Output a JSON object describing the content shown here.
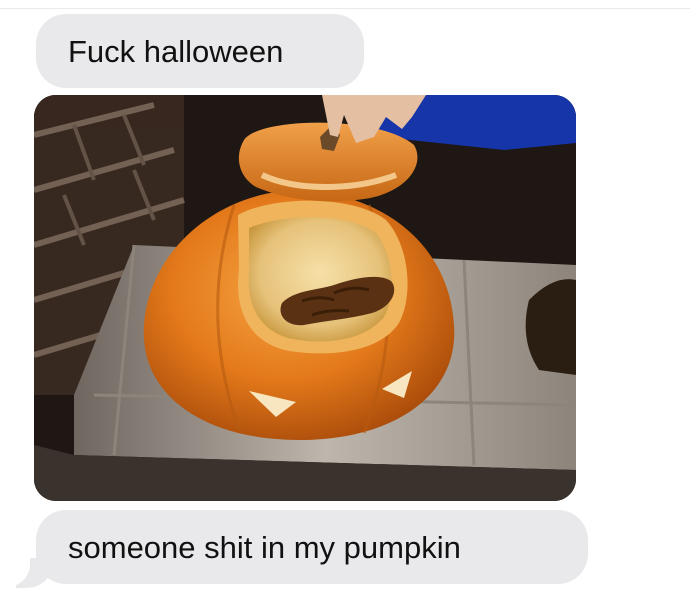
{
  "conversation": {
    "messages": [
      {
        "type": "text",
        "text": "Fuck halloween"
      },
      {
        "type": "image",
        "icon": "carved-pumpkin-photo"
      },
      {
        "type": "text",
        "text": "someone shit in my pumpkin"
      }
    ]
  },
  "colors": {
    "incoming_bubble": "#e9e9eb",
    "text": "#111111",
    "pumpkin": "#e8841e",
    "tarp": "#1535a8"
  }
}
